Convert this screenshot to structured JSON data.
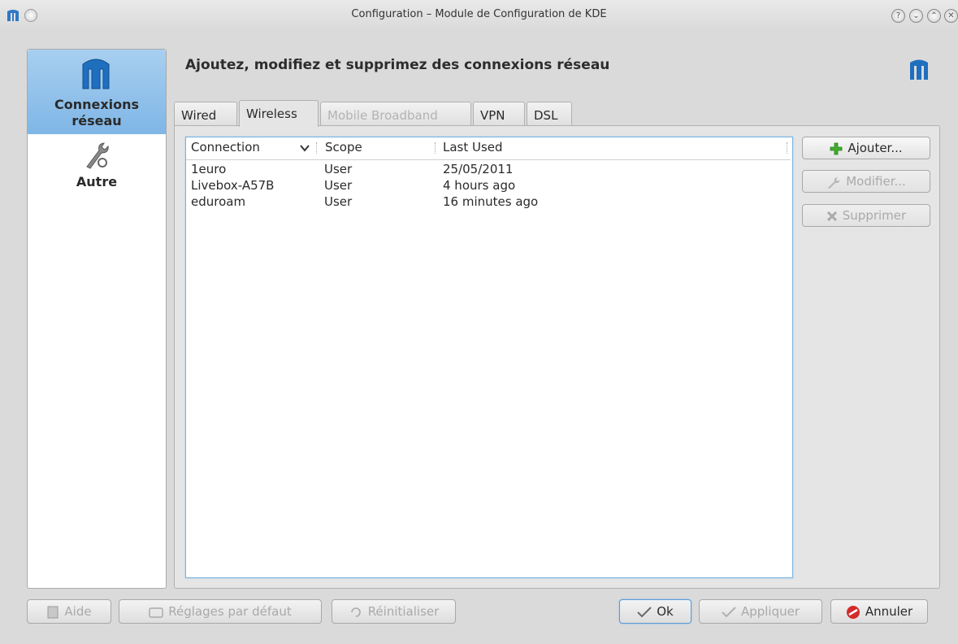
{
  "window": {
    "title": "Configuration – Module de Configuration de KDE"
  },
  "sidebar": {
    "items": [
      {
        "label_line1": "Connexions",
        "label_line2": "réseau",
        "selected": true,
        "icon": "network-manager-icon"
      },
      {
        "label_line1": "Autre",
        "selected": false,
        "icon": "wrench-gear-icon"
      }
    ]
  },
  "main": {
    "heading": "Ajoutez, modifiez et supprimez des connexions réseau",
    "tabs": [
      {
        "label": "Wired",
        "state": "normal"
      },
      {
        "label": "Wireless",
        "state": "active"
      },
      {
        "label": "Mobile Broadband",
        "state": "disabled"
      },
      {
        "label": "VPN",
        "state": "normal"
      },
      {
        "label": "DSL",
        "state": "normal"
      }
    ],
    "table": {
      "columns": [
        "Connection",
        "Scope",
        "Last Used"
      ],
      "sort_indicator": "chevron-down-icon",
      "rows": [
        {
          "connection": "1euro",
          "scope": "User",
          "last_used": "25/05/2011"
        },
        {
          "connection": "Livebox-A57B",
          "scope": "User",
          "last_used": "4 hours ago"
        },
        {
          "connection": "eduroam",
          "scope": "User",
          "last_used": "16 minutes ago"
        }
      ]
    },
    "actions": {
      "add": "Ajouter...",
      "edit": "Modifier...",
      "delete": "Supprimer"
    }
  },
  "footer": {
    "help": "Aide",
    "defaults": "Réglages par défaut",
    "reset": "Réinitialiser",
    "ok": "Ok",
    "apply": "Appliquer",
    "cancel": "Annuler"
  },
  "colors": {
    "selection": "#8fc1ec",
    "focus_border": "#79b3df",
    "add_icon": "#3fae2a",
    "cancel_icon": "#d42a2a"
  }
}
